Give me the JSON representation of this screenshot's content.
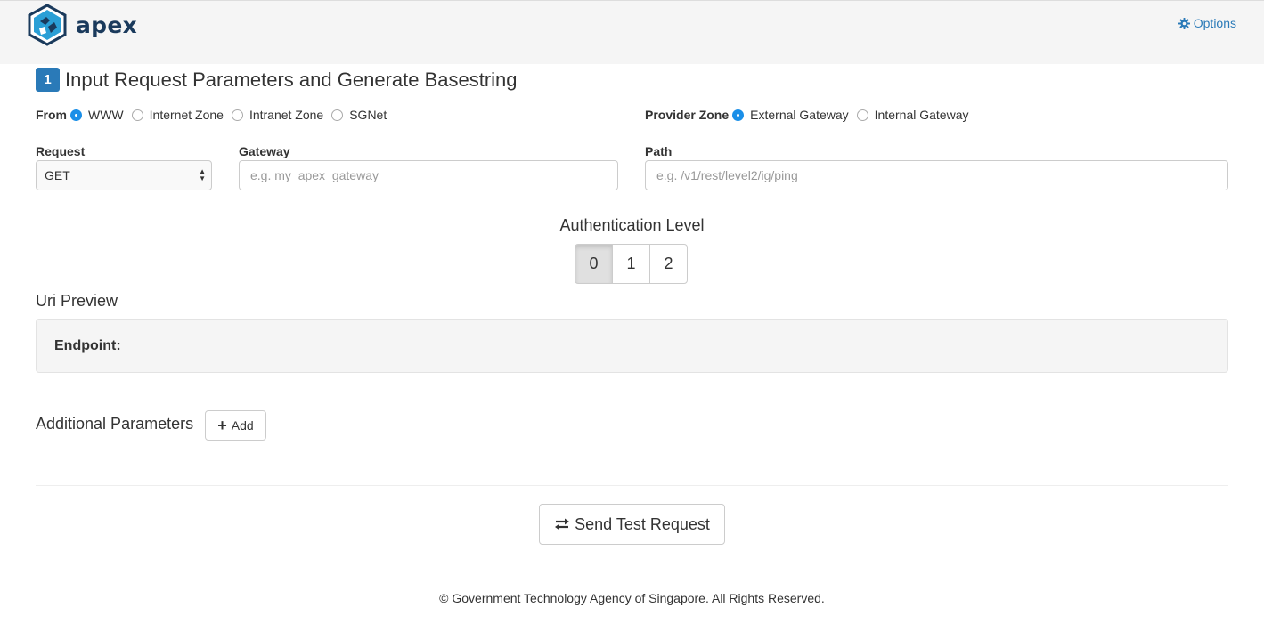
{
  "header": {
    "logo_text": "apex",
    "options_label": "Options"
  },
  "step": {
    "number": "1",
    "title": "Input Request Parameters and Generate Basestring"
  },
  "from": {
    "label": "From",
    "options": [
      "WWW",
      "Internet Zone",
      "Intranet Zone",
      "SGNet"
    ],
    "selected": "WWW"
  },
  "provider_zone": {
    "label": "Provider Zone",
    "options": [
      "External Gateway",
      "Internal Gateway"
    ],
    "selected": "External Gateway"
  },
  "request": {
    "label": "Request",
    "value": "GET"
  },
  "gateway": {
    "label": "Gateway",
    "placeholder": "e.g. my_apex_gateway"
  },
  "path": {
    "label": "Path",
    "placeholder": "e.g. /v1/rest/level2/ig/ping"
  },
  "auth": {
    "title": "Authentication Level",
    "levels": [
      "0",
      "1",
      "2"
    ],
    "selected": "0"
  },
  "uri_preview": {
    "title": "Uri Preview",
    "endpoint_label": "Endpoint:"
  },
  "additional": {
    "title": "Additional Parameters",
    "add_label": "Add"
  },
  "send_label": "Send Test Request",
  "footer": "© Government Technology Agency of Singapore. All Rights Reserved.",
  "colors": {
    "accent": "#2a7ab8",
    "radio_selected": "#1a8fe8",
    "logo": "#1a3a5c"
  },
  "icons": {
    "options": "gear-icon",
    "add": "plus-icon",
    "send": "transfer-arrows-icon"
  }
}
